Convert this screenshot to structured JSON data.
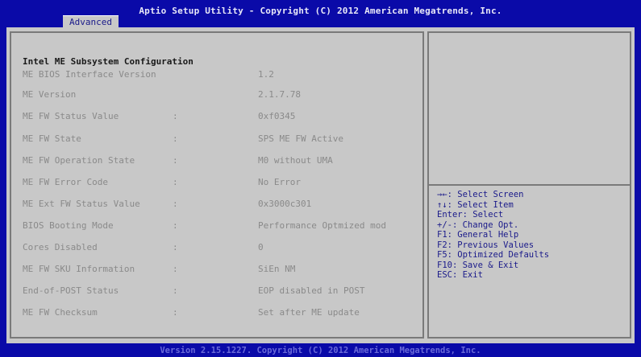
{
  "header": {
    "title": "Aptio Setup Utility - Copyright (C) 2012 American Megatrends, Inc.",
    "tab": "Advanced"
  },
  "main": {
    "section_title": "Intel ME Subsystem Configuration",
    "rows": [
      {
        "label": "ME BIOS Interface Version",
        "colon": "",
        "value": "1.2"
      },
      {
        "label": "ME Version",
        "colon": "",
        "value": "2.1.7.78"
      },
      {
        "label": "ME FW Status Value",
        "colon": ":",
        "value": "0xf0345"
      },
      {
        "label": "ME FW State",
        "colon": ":",
        "value": " SPS ME FW Active"
      },
      {
        "label": "ME FW Operation State",
        "colon": ":",
        "value": " M0 without UMA"
      },
      {
        "label": "ME FW Error Code",
        "colon": ":",
        "value": "No Error"
      },
      {
        "label": "ME Ext FW Status Value",
        "colon": ":",
        "value": "0x3000c301"
      },
      {
        "label": "BIOS Booting Mode",
        "colon": ":",
        "value": "Performance Optmized mod"
      },
      {
        "label": "Cores Disabled",
        "colon": ":",
        "value": "0"
      },
      {
        "label": "ME FW SKU Information",
        "colon": ":",
        "value": "SiEn NM"
      },
      {
        "label": "End-of-POST Status",
        "colon": ":",
        "value": "EOP disabled in POST"
      },
      {
        "label": "ME FW Checksum",
        "colon": ":",
        "value": "Set after ME update"
      }
    ]
  },
  "help": [
    "→←: Select Screen",
    "↑↓: Select Item",
    "Enter: Select",
    "+/-: Change Opt.",
    "F1: General Help",
    "F2: Previous Values",
    "F5: Optimized Defaults",
    "F10: Save & Exit",
    "ESC: Exit"
  ],
  "footer": {
    "text": "Version 2.15.1227. Copyright (C) 2012 American Megatrends, Inc."
  },
  "colors": {
    "background": "#0a0aa8",
    "panel": "#c8c8c8",
    "help_text": "#1a1a8a",
    "value_text": "#8a8a8a"
  }
}
